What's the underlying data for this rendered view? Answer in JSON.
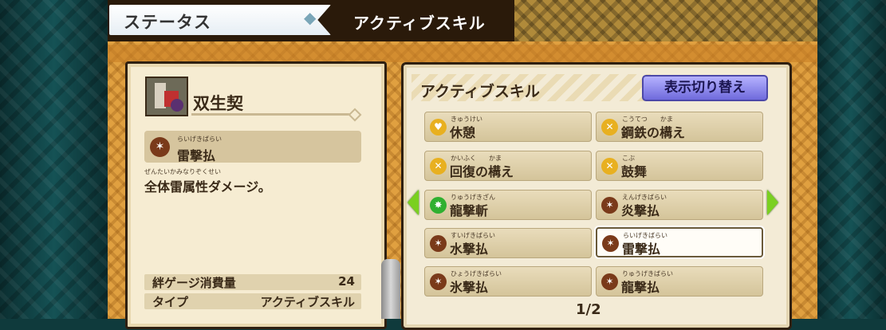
{
  "top_tabs": {
    "status": "ステータス",
    "active_skill": "アクティブスキル"
  },
  "kinship": {
    "name": "双生契",
    "skill_ruby": "らいげきばらい",
    "skill_name": "雷撃払",
    "desc_ruby": "ぜんたいかみなりぞくせい",
    "description": "全体雷属性ダメージ。",
    "gauge_label": "絆ゲージ消費量",
    "gauge_value": "24",
    "type_label": "タイプ",
    "type_value": "アクティブスキル"
  },
  "skill_panel": {
    "title": "アクティブスキル",
    "toggle_button": "表示切り替え",
    "page": "1/2",
    "skills": [
      {
        "ruby": "きゅうけい",
        "label": "休憩",
        "icon": "heart-icon",
        "color": "#e8b020"
      },
      {
        "ruby": "こうてつ　　かま",
        "label": "鋼鉄の構え",
        "icon": "stance-icon",
        "color": "#e8b020"
      },
      {
        "ruby": "かいふく　　かま",
        "label": "回復の構え",
        "icon": "stance-icon",
        "color": "#e8b020"
      },
      {
        "ruby": "こぶ",
        "label": "鼓舞",
        "icon": "stance-icon",
        "color": "#e8b020"
      },
      {
        "ruby": "りゅうげきざん",
        "label": "龍撃斬",
        "icon": "burst-icon",
        "color": "#30b030"
      },
      {
        "ruby": "えんげきばらい",
        "label": "炎撃払",
        "icon": "attack-icon",
        "color": "#7a3a1a"
      },
      {
        "ruby": "すいげきばらい",
        "label": "水撃払",
        "icon": "attack-icon",
        "color": "#7a3a1a"
      },
      {
        "ruby": "らいげきばらい",
        "label": "雷撃払",
        "icon": "attack-icon",
        "color": "#7a3a1a",
        "selected": true
      },
      {
        "ruby": "ひょうげきばらい",
        "label": "氷撃払",
        "icon": "attack-icon",
        "color": "#7a3a1a"
      },
      {
        "ruby": "りゅうげきばらい",
        "label": "龍撃払",
        "icon": "attack-icon",
        "color": "#7a3a1a"
      }
    ]
  }
}
